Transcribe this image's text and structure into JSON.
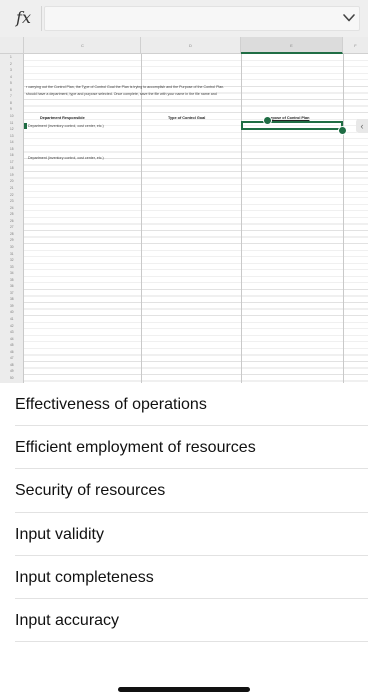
{
  "formula_bar": {
    "fx_label": "fx",
    "value": "",
    "expand_icon": "chevron-down-icon"
  },
  "sheet": {
    "column_headers": [
      "A",
      "C",
      "D",
      "E",
      "F"
    ],
    "row_numbers": [
      "1",
      "2",
      "3",
      "4",
      "5",
      "6",
      "7",
      "8",
      "9",
      "10",
      "11",
      "12",
      "13",
      "14",
      "15",
      "16",
      "17",
      "18",
      "19",
      "20",
      "21",
      "22",
      "23",
      "24",
      "25",
      "26",
      "27",
      "28",
      "29",
      "30",
      "31",
      "32",
      "33",
      "34",
      "35",
      "36",
      "37",
      "38",
      "39",
      "40",
      "41",
      "42",
      "43",
      "44",
      "45",
      "46",
      "47",
      "48",
      "49",
      "50"
    ],
    "instruction_line1": "r carrying out the Control Plan, the Type of Control Goal the Plan is trying to accomplish and the Purpose of the Control Plan.",
    "instruction_line2": "should have a department, type and purpose selected.  Once complete, save the file with your name in the file  name and",
    "header_department": "Department Responsible",
    "header_type": "Type of Control Goal",
    "header_purpose": "Purpose of Control Plan",
    "row1_department": "Department (inventory control, cost center, etc.)",
    "row2_department": "Department (inventory control, cost center, etc.)",
    "side_tab_icon": "chevron-left-icon"
  },
  "dropdown_options": [
    "Effectiveness of operations",
    "Efficient employment of resources",
    "Security of resources",
    "Input validity",
    "Input completeness",
    "Input accuracy"
  ],
  "colors": {
    "selection": "#1f6d44",
    "formula_bar_bg": "#efefef",
    "header_bg": "#ececec"
  }
}
